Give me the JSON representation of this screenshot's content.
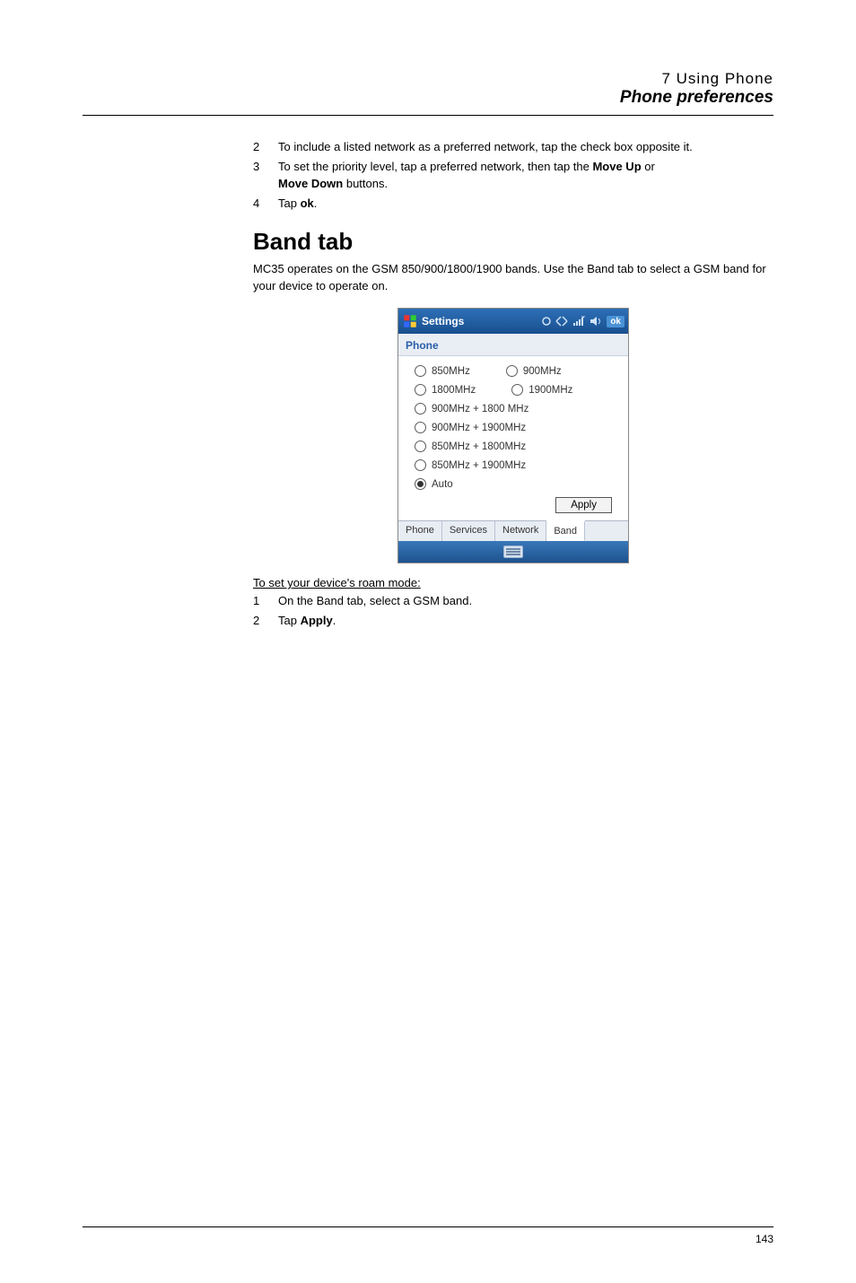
{
  "header": {
    "chapter": "7 Using Phone",
    "section": "Phone preferences"
  },
  "list_a": [
    {
      "n": "2",
      "text_parts": [
        "To include a listed network as a preferred network, tap the check box opposite it."
      ]
    },
    {
      "n": "3",
      "text_parts": [
        "To set the priority level, tap a preferred network, then tap the ",
        "Move Up",
        " or ",
        "Move Down",
        " buttons."
      ]
    },
    {
      "n": "4",
      "text_parts": [
        "Tap ",
        "ok",
        "."
      ]
    }
  ],
  "heading_band": "Band tab",
  "para_band": "MC35 operates on the GSM 850/900/1800/1900 bands. Use the Band tab to select a GSM band for your device to operate on.",
  "screenshot": {
    "title": "Settings",
    "ok": "ok",
    "subheading": "Phone",
    "radios": {
      "r850": "850MHz",
      "r900": "900MHz",
      "r1800": "1800MHz",
      "r1900": "1900MHz",
      "r900_1800": "900MHz + 1800 MHz",
      "r900_1900": "900MHz + 1900MHz",
      "r850_1800": "850MHz + 1800MHz",
      "r850_1900": "850MHz + 1900MHz",
      "auto": "Auto"
    },
    "apply": "Apply",
    "tabs": {
      "phone": "Phone",
      "services": "Services",
      "network": "Network",
      "band": "Band"
    }
  },
  "under_heading": "To set your device's roam mode:",
  "list_b": [
    {
      "n": "1",
      "text_parts": [
        "On the Band tab, select a GSM band."
      ]
    },
    {
      "n": "2",
      "text_parts": [
        "Tap ",
        "Apply",
        "."
      ]
    }
  ],
  "page_number": "143"
}
